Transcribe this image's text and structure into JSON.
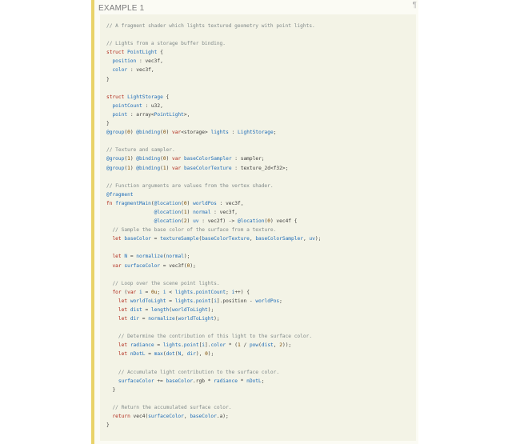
{
  "example_label": "EXAMPLE 1",
  "pilcrow": "¶",
  "colors": {
    "accent_border": "#e9d36a",
    "code_background": "#f3f3e6",
    "comment": "#818a8a",
    "keyword": "#b02a1c",
    "identifier": "#1e6cb8"
  },
  "code": [
    [
      {
        "t": "// A fragment shader which lights textured geometry with point lights.",
        "c": "c"
      }
    ],
    [],
    [
      {
        "t": "// Lights from a storage buffer binding.",
        "c": "c"
      }
    ],
    [
      {
        "t": "struct",
        "c": "k"
      },
      {
        "t": " "
      },
      {
        "t": "PointLight",
        "c": "f"
      },
      {
        "t": " {"
      }
    ],
    [
      {
        "t": "  "
      },
      {
        "t": "position",
        "c": "f"
      },
      {
        "t": " : vec3f,"
      }
    ],
    [
      {
        "t": "  "
      },
      {
        "t": "color",
        "c": "f"
      },
      {
        "t": " : vec3f,"
      }
    ],
    [
      {
        "t": "}"
      }
    ],
    [],
    [
      {
        "t": "struct",
        "c": "k"
      },
      {
        "t": " "
      },
      {
        "t": "LightStorage",
        "c": "f"
      },
      {
        "t": " {"
      }
    ],
    [
      {
        "t": "  "
      },
      {
        "t": "pointCount",
        "c": "f"
      },
      {
        "t": " : u32,"
      }
    ],
    [
      {
        "t": "  "
      },
      {
        "t": "point",
        "c": "f"
      },
      {
        "t": " : array<"
      },
      {
        "t": "PointLight",
        "c": "f"
      },
      {
        "t": ">,"
      }
    ],
    [
      {
        "t": "}"
      }
    ],
    [
      {
        "t": "@group",
        "c": "f"
      },
      {
        "t": "("
      },
      {
        "t": "0",
        "c": "n"
      },
      {
        "t": ") "
      },
      {
        "t": "@binding",
        "c": "f"
      },
      {
        "t": "("
      },
      {
        "t": "0",
        "c": "n"
      },
      {
        "t": ") "
      },
      {
        "t": "var",
        "c": "k"
      },
      {
        "t": "<storage> "
      },
      {
        "t": "lights",
        "c": "f"
      },
      {
        "t": " : "
      },
      {
        "t": "LightStorage",
        "c": "f"
      },
      {
        "t": ";"
      }
    ],
    [],
    [
      {
        "t": "// Texture and sampler.",
        "c": "c"
      }
    ],
    [
      {
        "t": "@group",
        "c": "f"
      },
      {
        "t": "("
      },
      {
        "t": "1",
        "c": "n"
      },
      {
        "t": ") "
      },
      {
        "t": "@binding",
        "c": "f"
      },
      {
        "t": "("
      },
      {
        "t": "0",
        "c": "n"
      },
      {
        "t": ") "
      },
      {
        "t": "var",
        "c": "k"
      },
      {
        "t": " "
      },
      {
        "t": "baseColorSampler",
        "c": "f"
      },
      {
        "t": " : sampler;"
      }
    ],
    [
      {
        "t": "@group",
        "c": "f"
      },
      {
        "t": "("
      },
      {
        "t": "1",
        "c": "n"
      },
      {
        "t": ") "
      },
      {
        "t": "@binding",
        "c": "f"
      },
      {
        "t": "("
      },
      {
        "t": "1",
        "c": "n"
      },
      {
        "t": ") "
      },
      {
        "t": "var",
        "c": "k"
      },
      {
        "t": " "
      },
      {
        "t": "baseColorTexture",
        "c": "f"
      },
      {
        "t": " : texture_2d<f32>;"
      }
    ],
    [],
    [
      {
        "t": "// Function arguments are values from the vertex shader.",
        "c": "c"
      }
    ],
    [
      {
        "t": "@fragment",
        "c": "f"
      }
    ],
    [
      {
        "t": "fn",
        "c": "k"
      },
      {
        "t": " "
      },
      {
        "t": "fragmentMain",
        "c": "f"
      },
      {
        "t": "("
      },
      {
        "t": "@location",
        "c": "f"
      },
      {
        "t": "("
      },
      {
        "t": "0",
        "c": "n"
      },
      {
        "t": ") "
      },
      {
        "t": "worldPos",
        "c": "f"
      },
      {
        "t": " : vec3f,"
      }
    ],
    [
      {
        "t": "                "
      },
      {
        "t": "@location",
        "c": "f"
      },
      {
        "t": "("
      },
      {
        "t": "1",
        "c": "n"
      },
      {
        "t": ") "
      },
      {
        "t": "normal",
        "c": "f"
      },
      {
        "t": " : vec3f,"
      }
    ],
    [
      {
        "t": "                "
      },
      {
        "t": "@location",
        "c": "f"
      },
      {
        "t": "("
      },
      {
        "t": "2",
        "c": "n"
      },
      {
        "t": ") "
      },
      {
        "t": "uv",
        "c": "f"
      },
      {
        "t": " : vec2f) -> "
      },
      {
        "t": "@location",
        "c": "f"
      },
      {
        "t": "("
      },
      {
        "t": "0",
        "c": "n"
      },
      {
        "t": ") vec4f {"
      }
    ],
    [
      {
        "t": "  "
      },
      {
        "t": "// Sample the base color of the surface from a texture.",
        "c": "c"
      }
    ],
    [
      {
        "t": "  "
      },
      {
        "t": "let",
        "c": "k"
      },
      {
        "t": " "
      },
      {
        "t": "baseColor",
        "c": "f"
      },
      {
        "t": " = "
      },
      {
        "t": "textureSample",
        "c": "f"
      },
      {
        "t": "("
      },
      {
        "t": "baseColorTexture",
        "c": "f"
      },
      {
        "t": ", "
      },
      {
        "t": "baseColorSampler",
        "c": "f"
      },
      {
        "t": ", "
      },
      {
        "t": "uv",
        "c": "f"
      },
      {
        "t": ");"
      }
    ],
    [],
    [
      {
        "t": "  "
      },
      {
        "t": "let",
        "c": "k"
      },
      {
        "t": " "
      },
      {
        "t": "N",
        "c": "f"
      },
      {
        "t": " = "
      },
      {
        "t": "normalize",
        "c": "f"
      },
      {
        "t": "("
      },
      {
        "t": "normal",
        "c": "f"
      },
      {
        "t": ");"
      }
    ],
    [
      {
        "t": "  "
      },
      {
        "t": "var",
        "c": "k"
      },
      {
        "t": " "
      },
      {
        "t": "surfaceColor",
        "c": "f"
      },
      {
        "t": " = vec3f("
      },
      {
        "t": "0",
        "c": "n"
      },
      {
        "t": ");"
      }
    ],
    [],
    [
      {
        "t": "  "
      },
      {
        "t": "// Loop over the scene point lights.",
        "c": "c"
      }
    ],
    [
      {
        "t": "  "
      },
      {
        "t": "for",
        "c": "k"
      },
      {
        "t": " ("
      },
      {
        "t": "var",
        "c": "k"
      },
      {
        "t": " "
      },
      {
        "t": "i",
        "c": "f"
      },
      {
        "t": " = "
      },
      {
        "t": "0u",
        "c": "n"
      },
      {
        "t": "; "
      },
      {
        "t": "i",
        "c": "f"
      },
      {
        "t": " < "
      },
      {
        "t": "lights",
        "c": "f"
      },
      {
        "t": "."
      },
      {
        "t": "pointCount",
        "c": "f"
      },
      {
        "t": "; "
      },
      {
        "t": "i",
        "c": "f"
      },
      {
        "t": "++) {"
      }
    ],
    [
      {
        "t": "    "
      },
      {
        "t": "let",
        "c": "k"
      },
      {
        "t": " "
      },
      {
        "t": "worldToLight",
        "c": "f"
      },
      {
        "t": " = "
      },
      {
        "t": "lights",
        "c": "f"
      },
      {
        "t": "."
      },
      {
        "t": "point",
        "c": "f"
      },
      {
        "t": "["
      },
      {
        "t": "i",
        "c": "f"
      },
      {
        "t": "].position - "
      },
      {
        "t": "worldPos",
        "c": "f"
      },
      {
        "t": ";"
      }
    ],
    [
      {
        "t": "    "
      },
      {
        "t": "let",
        "c": "k"
      },
      {
        "t": " "
      },
      {
        "t": "dist",
        "c": "f"
      },
      {
        "t": " = "
      },
      {
        "t": "length",
        "c": "f"
      },
      {
        "t": "("
      },
      {
        "t": "worldToLight",
        "c": "f"
      },
      {
        "t": ");"
      }
    ],
    [
      {
        "t": "    "
      },
      {
        "t": "let",
        "c": "k"
      },
      {
        "t": " "
      },
      {
        "t": "dir",
        "c": "f"
      },
      {
        "t": " = "
      },
      {
        "t": "normalize",
        "c": "f"
      },
      {
        "t": "("
      },
      {
        "t": "worldToLight",
        "c": "f"
      },
      {
        "t": ");"
      }
    ],
    [],
    [
      {
        "t": "    "
      },
      {
        "t": "// Determine the contribution of this light to the surface color.",
        "c": "c"
      }
    ],
    [
      {
        "t": "    "
      },
      {
        "t": "let",
        "c": "k"
      },
      {
        "t": " "
      },
      {
        "t": "radiance",
        "c": "f"
      },
      {
        "t": " = "
      },
      {
        "t": "lights",
        "c": "f"
      },
      {
        "t": "."
      },
      {
        "t": "point",
        "c": "f"
      },
      {
        "t": "["
      },
      {
        "t": "i",
        "c": "f"
      },
      {
        "t": "]."
      },
      {
        "t": "color",
        "c": "f"
      },
      {
        "t": " * ("
      },
      {
        "t": "1",
        "c": "n"
      },
      {
        "t": " / "
      },
      {
        "t": "pow",
        "c": "f"
      },
      {
        "t": "("
      },
      {
        "t": "dist",
        "c": "f"
      },
      {
        "t": ", "
      },
      {
        "t": "2",
        "c": "n"
      },
      {
        "t": "));"
      }
    ],
    [
      {
        "t": "    "
      },
      {
        "t": "let",
        "c": "k"
      },
      {
        "t": " "
      },
      {
        "t": "nDotL",
        "c": "f"
      },
      {
        "t": " = "
      },
      {
        "t": "max",
        "c": "f"
      },
      {
        "t": "("
      },
      {
        "t": "dot",
        "c": "f"
      },
      {
        "t": "("
      },
      {
        "t": "N",
        "c": "f"
      },
      {
        "t": ", "
      },
      {
        "t": "dir",
        "c": "f"
      },
      {
        "t": "), "
      },
      {
        "t": "0",
        "c": "n"
      },
      {
        "t": ");"
      }
    ],
    [],
    [
      {
        "t": "    "
      },
      {
        "t": "// Accumulate light contribution to the surface color.",
        "c": "c"
      }
    ],
    [
      {
        "t": "    "
      },
      {
        "t": "surfaceColor",
        "c": "f"
      },
      {
        "t": " += "
      },
      {
        "t": "baseColor",
        "c": "f"
      },
      {
        "t": ".rgb * "
      },
      {
        "t": "radiance",
        "c": "f"
      },
      {
        "t": " * "
      },
      {
        "t": "nDotL",
        "c": "f"
      },
      {
        "t": ";"
      }
    ],
    [
      {
        "t": "  }"
      }
    ],
    [],
    [
      {
        "t": "  "
      },
      {
        "t": "// Return the accumulated surface color.",
        "c": "c"
      }
    ],
    [
      {
        "t": "  "
      },
      {
        "t": "return",
        "c": "k"
      },
      {
        "t": " vec4("
      },
      {
        "t": "surfaceColor",
        "c": "f"
      },
      {
        "t": ", "
      },
      {
        "t": "baseColor",
        "c": "f"
      },
      {
        "t": ".a);"
      }
    ],
    [
      {
        "t": "}"
      }
    ]
  ]
}
